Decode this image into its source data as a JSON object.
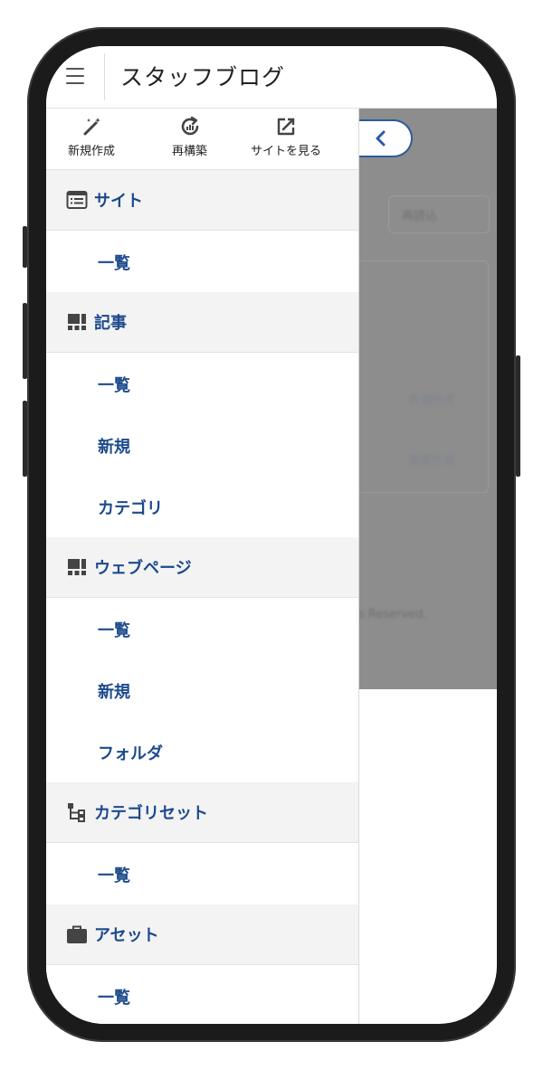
{
  "header": {
    "title": "スタッフブログ"
  },
  "toolbar": {
    "new_label": "新規作成",
    "rebuild_label": "再構築",
    "view_site_label": "サイトを見る"
  },
  "sidebar": {
    "sections": [
      {
        "label": "サイト",
        "icon": "site-list-icon",
        "items": [
          "一覧"
        ]
      },
      {
        "label": "記事",
        "icon": "grid-icon",
        "items": [
          "一覧",
          "新規",
          "カテゴリ"
        ]
      },
      {
        "label": "ウェブページ",
        "icon": "grid-icon",
        "items": [
          "一覧",
          "新規",
          "フォルダ"
        ]
      },
      {
        "label": "カテゴリセット",
        "icon": "tree-icon",
        "items": [
          "一覧"
        ]
      },
      {
        "label": "アセット",
        "icon": "briefcase-icon",
        "items": [
          "一覧"
        ]
      }
    ]
  },
  "background": {
    "reread_button": "再読込",
    "new_link_1": "新規作成",
    "new_link_2": "新規作成",
    "footer_text": "s Reserved."
  },
  "colors": {
    "link": "#1c4a8c",
    "section_bg": "#f3f3f3",
    "overlay": "#8d8d8d",
    "accent": "#2c5aa0"
  }
}
